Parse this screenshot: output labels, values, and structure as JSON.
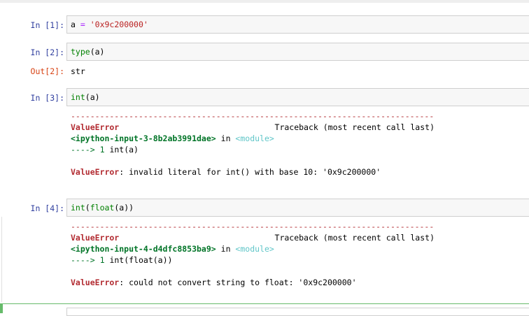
{
  "cells": [
    {
      "in_prompt": "In [1]:",
      "code": [
        {
          "text": "a ",
          "cls": ""
        },
        {
          "text": "=",
          "cls": "op"
        },
        {
          "text": " ",
          "cls": ""
        },
        {
          "text": "'0x9c200000'",
          "cls": "str"
        }
      ]
    },
    {
      "in_prompt": "In [2]:",
      "code": [
        {
          "text": "type",
          "cls": "bi"
        },
        {
          "text": "(a)",
          "cls": ""
        }
      ],
      "out_prompt": "Out[2]:",
      "output": "str"
    },
    {
      "in_prompt": "In [3]:",
      "code": [
        {
          "text": "int",
          "cls": "bi"
        },
        {
          "text": "(a)",
          "cls": ""
        }
      ],
      "traceback": {
        "dashes": "---------------------------------------------------------------------------",
        "error_name": "ValueError",
        "header_right": "Traceback (most recent call last)",
        "file": "<ipython-input-3-8b2ab3991dae>",
        "in_word": " in ",
        "module": "<module>",
        "arrow": "---->",
        "line_no": "1",
        "line_code": "int(a)",
        "message_name": "ValueError",
        "message": ": invalid literal for int() with base 10: '0x9c200000'"
      }
    },
    {
      "in_prompt": "In [4]:",
      "code": [
        {
          "text": "int",
          "cls": "bi"
        },
        {
          "text": "(",
          "cls": ""
        },
        {
          "text": "float",
          "cls": "bi"
        },
        {
          "text": "(a))",
          "cls": ""
        }
      ],
      "traceback": {
        "dashes": "---------------------------------------------------------------------------",
        "error_name": "ValueError",
        "header_right": "Traceback (most recent call last)",
        "file": "<ipython-input-4-d4dfc8853ba9>",
        "in_word": " in ",
        "module": "<module>",
        "arrow": "---->",
        "line_no": "1",
        "line_code": "int(float(a))",
        "message_name": "ValueError",
        "message": ": could not convert string to float: '0x9c200000'"
      }
    }
  ]
}
